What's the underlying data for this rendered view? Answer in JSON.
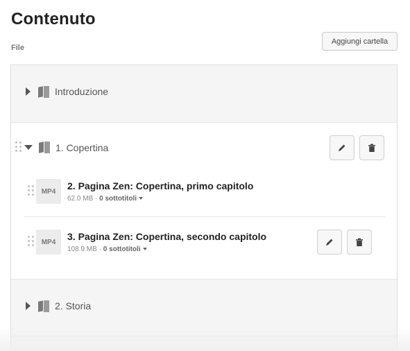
{
  "header": {
    "title": "Contenuto",
    "section_label": "File",
    "add_folder_label": "Aggiungi cartella"
  },
  "folders": [
    {
      "title": "Introduzione",
      "expanded": false
    },
    {
      "title": "1. Copertina",
      "expanded": true,
      "files": [
        {
          "thumb": "MP4",
          "title": "2. Pagina Zen: Copertina, primo capitolo",
          "size": "62.0 MB",
          "separator": "·",
          "subtitles": "0 sottotitoli"
        },
        {
          "thumb": "MP4",
          "title": "3. Pagina Zen: Copertina, secondo capitolo",
          "size": "108.9 MB",
          "separator": "·",
          "subtitles": "0 sottotitoli"
        }
      ]
    },
    {
      "title": "2. Storia",
      "expanded": false
    }
  ],
  "icons": {
    "edit": "pencil-icon",
    "delete": "trash-icon",
    "folder": "book-icon",
    "drag": "drag-handle-icon"
  }
}
